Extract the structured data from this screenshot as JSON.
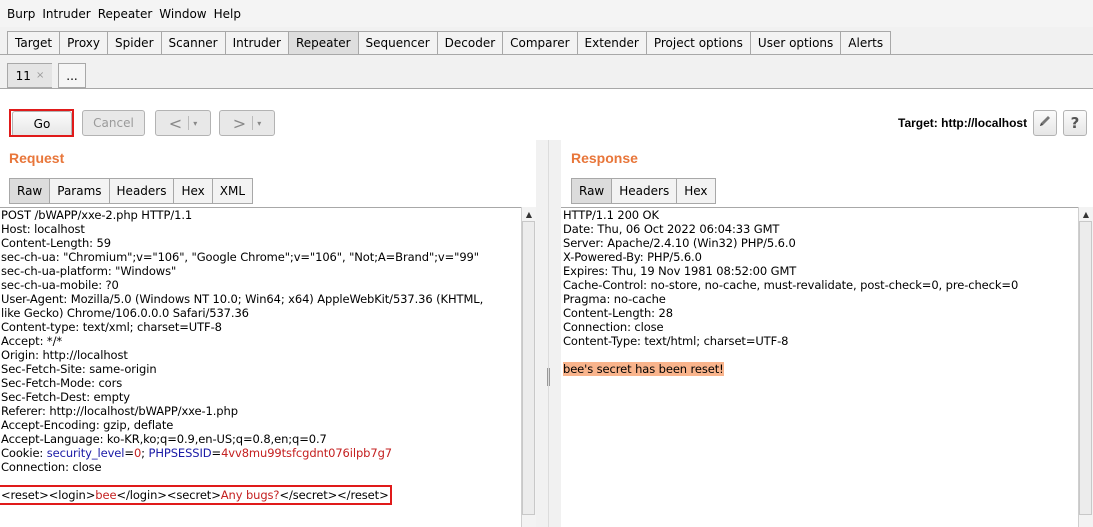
{
  "menu": [
    "Burp",
    "Intruder",
    "Repeater",
    "Window",
    "Help"
  ],
  "main_tabs": [
    "Target",
    "Proxy",
    "Spider",
    "Scanner",
    "Intruder",
    "Repeater",
    "Sequencer",
    "Decoder",
    "Comparer",
    "Extender",
    "Project options",
    "User options",
    "Alerts"
  ],
  "active_main_tab": "Repeater",
  "sub_tabs": {
    "current": "11",
    "close": "×",
    "new": "..."
  },
  "toolbar": {
    "go": "Go",
    "cancel": "Cancel",
    "back": "<",
    "forward": ">",
    "dropdown": "▾",
    "target_label": "Target: http://localhost",
    "edit_icon": "pencil-icon",
    "help_icon": "?"
  },
  "request": {
    "title": "Request",
    "tabs": [
      "Raw",
      "Params",
      "Headers",
      "Hex",
      "XML"
    ],
    "active_tab": "Raw",
    "lines": [
      "POST /bWAPP/xxe-2.php HTTP/1.1",
      "Host: localhost",
      "Content-Length: 59",
      "sec-ch-ua: \"Chromium\";v=\"106\", \"Google Chrome\";v=\"106\", \"Not;A=Brand\";v=\"99\"",
      "sec-ch-ua-platform: \"Windows\"",
      "sec-ch-ua-mobile: ?0",
      "User-Agent: Mozilla/5.0 (Windows NT 10.0; Win64; x64) AppleWebKit/537.36 (KHTML,",
      "like Gecko) Chrome/106.0.0.0 Safari/537.36",
      "Content-type: text/xml; charset=UTF-8",
      "Accept: */*",
      "Origin: http://localhost",
      "Sec-Fetch-Site: same-origin",
      "Sec-Fetch-Mode: cors",
      "Sec-Fetch-Dest: empty",
      "Referer: http://localhost/bWAPP/xxe-1.php",
      "Accept-Encoding: gzip, deflate",
      "Accept-Language: ko-KR,ko;q=0.9,en-US;q=0.8,en;q=0.7"
    ],
    "cookie": {
      "prefix": "Cookie: ",
      "name1": "security_level",
      "eq1": "=",
      "val1": "0",
      "sep": "; ",
      "name2": "PHPSESSID",
      "eq2": "=",
      "val2": "4vv8mu99tsfcgdnt076ilpb7g7"
    },
    "connection": "Connection: close",
    "body": {
      "p1": "<reset><login>",
      "v1": "bee",
      "p2": "</login><secret>",
      "v2": "Any bugs?",
      "p3": "</secret></reset>"
    }
  },
  "response": {
    "title": "Response",
    "tabs": [
      "Raw",
      "Headers",
      "Hex"
    ],
    "active_tab": "Raw",
    "lines": [
      "HTTP/1.1 200 OK",
      "Date: Thu, 06 Oct 2022 06:04:33 GMT",
      "Server: Apache/2.4.10 (Win32) PHP/5.6.0",
      "X-Powered-By: PHP/5.6.0",
      "Expires: Thu, 19 Nov 1981 08:52:00 GMT",
      "Cache-Control: no-store, no-cache, must-revalidate, post-check=0, pre-check=0",
      "Pragma: no-cache",
      "Content-Length: 28",
      "Connection: close",
      "Content-Type: text/html; charset=UTF-8"
    ],
    "body": "bee's secret has been reset!"
  },
  "colors": {
    "accent": "#e8763a",
    "highlight_box": "#e01a1a",
    "cookie_name": "#1a1aa6",
    "cookie_value": "#c42020",
    "response_highlight": "#f9b48c"
  }
}
